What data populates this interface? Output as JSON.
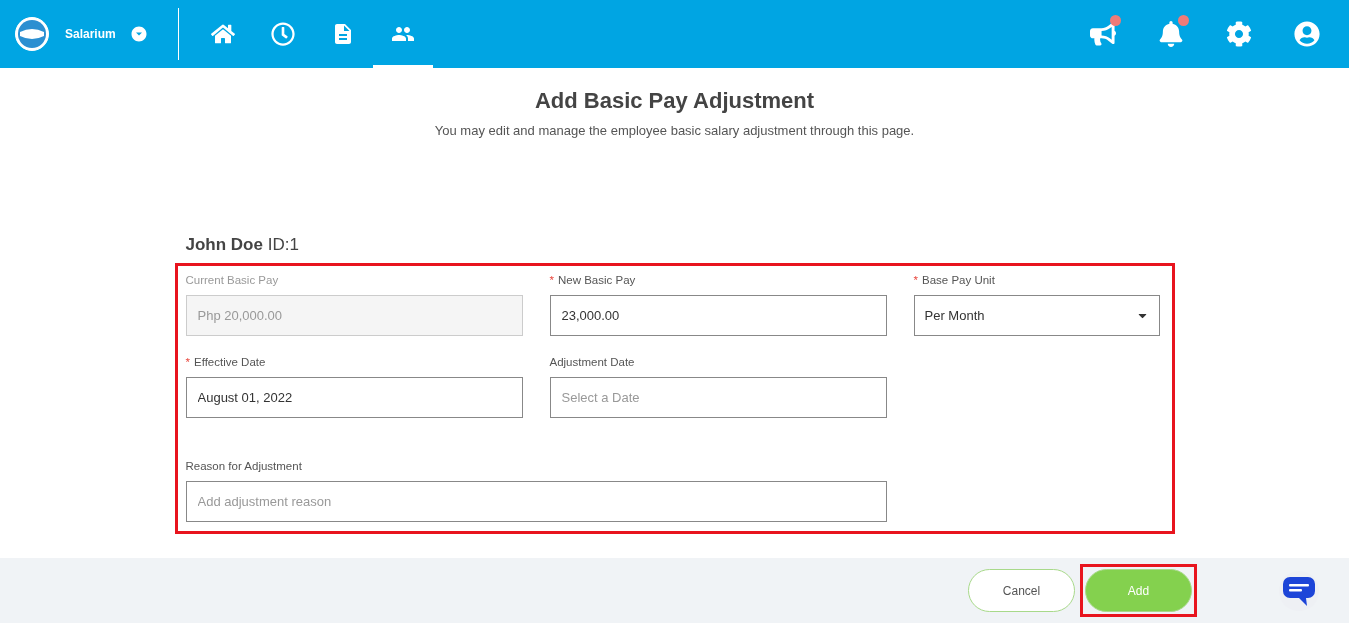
{
  "header": {
    "brand": "Salarium",
    "nav": [
      {
        "selected": false
      },
      {
        "selected": false
      },
      {
        "selected": false
      },
      {
        "selected": true
      }
    ],
    "actions": [
      {
        "badge": true
      },
      {
        "badge": true
      },
      {
        "badge": false
      },
      {
        "badge": false
      }
    ]
  },
  "page": {
    "title": "Add Basic Pay Adjustment",
    "subtitle": "You may edit and manage the employee basic salary adjustment through this page."
  },
  "employee": {
    "name": "John Doe",
    "id": "ID:1"
  },
  "form": {
    "highlighted": true,
    "fields": [
      {
        "kind": "input",
        "label": "Current Basic Pay",
        "disabled": true,
        "value": "Php 20,000.00",
        "wide": false
      },
      {
        "kind": "input",
        "label": "New Basic Pay",
        "required_mark": "*",
        "disabled": false,
        "value": "23,000.00",
        "wide": false
      },
      {
        "kind": "select",
        "label": "Base Pay Unit",
        "required_mark": "*",
        "value": "Per Month",
        "wide": false
      },
      {
        "kind": "input",
        "label": "Effective Date",
        "required_mark": "*",
        "disabled": false,
        "value": "August 01, 2022",
        "wide": false
      },
      {
        "kind": "input",
        "label": "Adjustment Date",
        "disabled": false,
        "placeholder": "Select a Date",
        "wide": false
      },
      {
        "kind": "input",
        "label": "Reason for Adjustment",
        "disabled": false,
        "placeholder": "Add adjustment reason",
        "wide": true
      }
    ]
  },
  "footer": {
    "buttons": [
      {
        "kind": "secondary",
        "label": "Cancel",
        "highlighted": false
      },
      {
        "kind": "primary",
        "label": "Add",
        "highlighted": true
      }
    ]
  }
}
